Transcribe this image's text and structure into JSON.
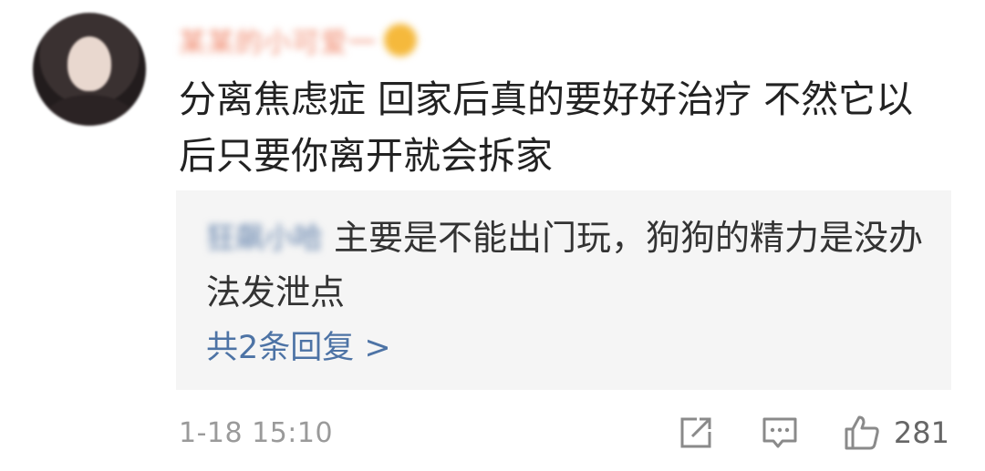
{
  "comment": {
    "username": "某某的小可爱一",
    "text": "分离焦虑症 回家后真的要好好治疗 不然它以后只要你离开就会拆家",
    "reply": {
      "username": "狂飙小哈",
      "text": "主要是不能出门玩，狗狗的精力是没办法发泄点",
      "more_label": "共2条回复 >"
    },
    "timestamp": "1-18 15:10",
    "likes": "281",
    "icons": {
      "share": "share-icon",
      "reply": "comment-icon",
      "like": "thumbs-up-icon"
    },
    "colors": {
      "link": "#4d73a5",
      "username": "#f08a6e",
      "reply_bg": "#f5f5f5"
    }
  }
}
